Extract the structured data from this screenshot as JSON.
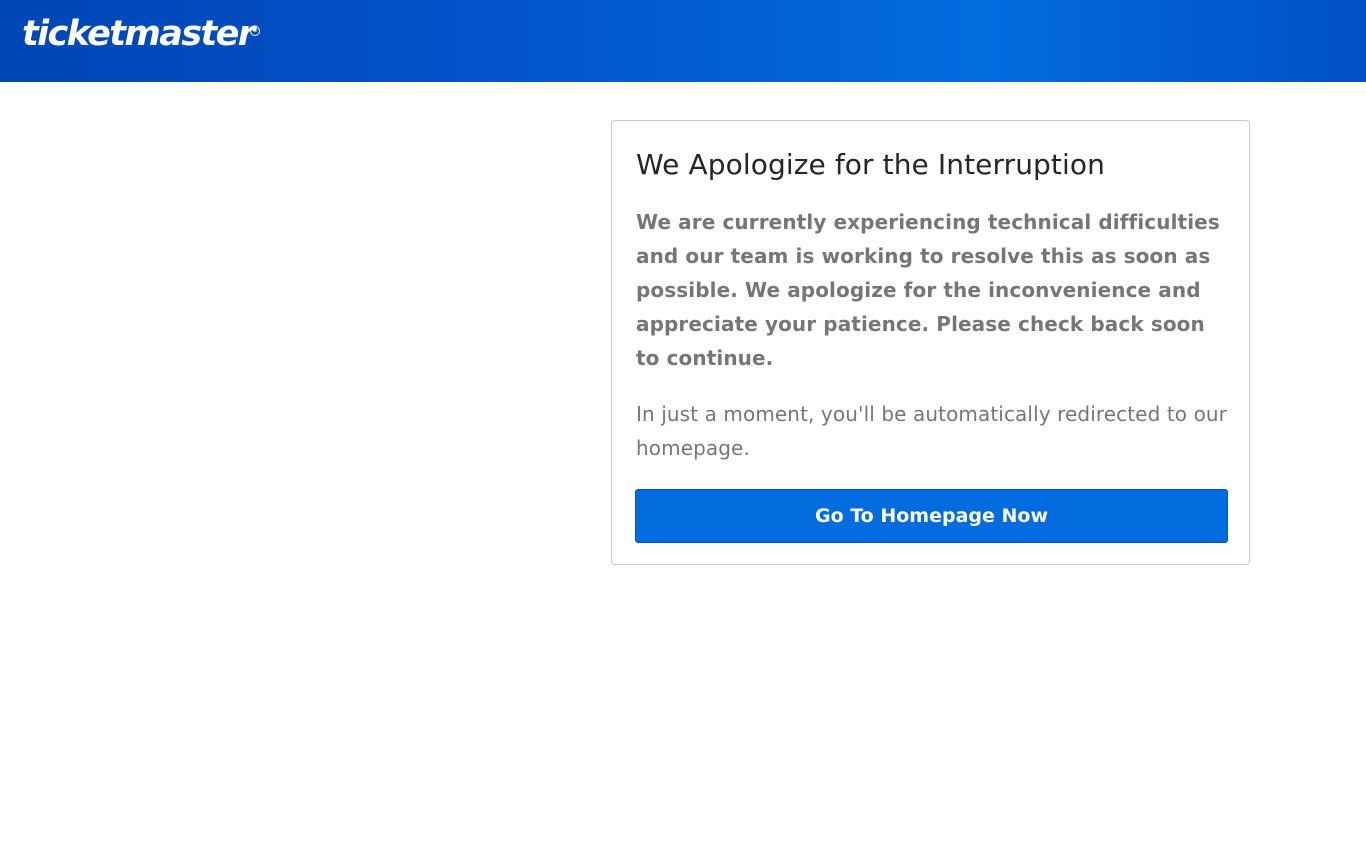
{
  "header": {
    "logo_text": "ticketmaster",
    "logo_registered": "®",
    "gradient_colors": [
      "#0046b5",
      "#026cdf",
      "#0150c4"
    ]
  },
  "card": {
    "title": "We Apologize for the Interruption",
    "message": "We are currently experiencing technical difficulties and our team is working to resolve this as soon as possible. We apologize for the inconvenience and appreciate your patience. Please check back soon to continue.",
    "redirect_notice": "In just a moment, you'll be automatically redirected to our homepage.",
    "button_label": "Go To Homepage Now"
  },
  "colors": {
    "brand_blue": "#026cdf",
    "title_text": "#262626",
    "body_text": "#767676",
    "card_border": "#c9c9c9",
    "background": "#ffffff"
  }
}
